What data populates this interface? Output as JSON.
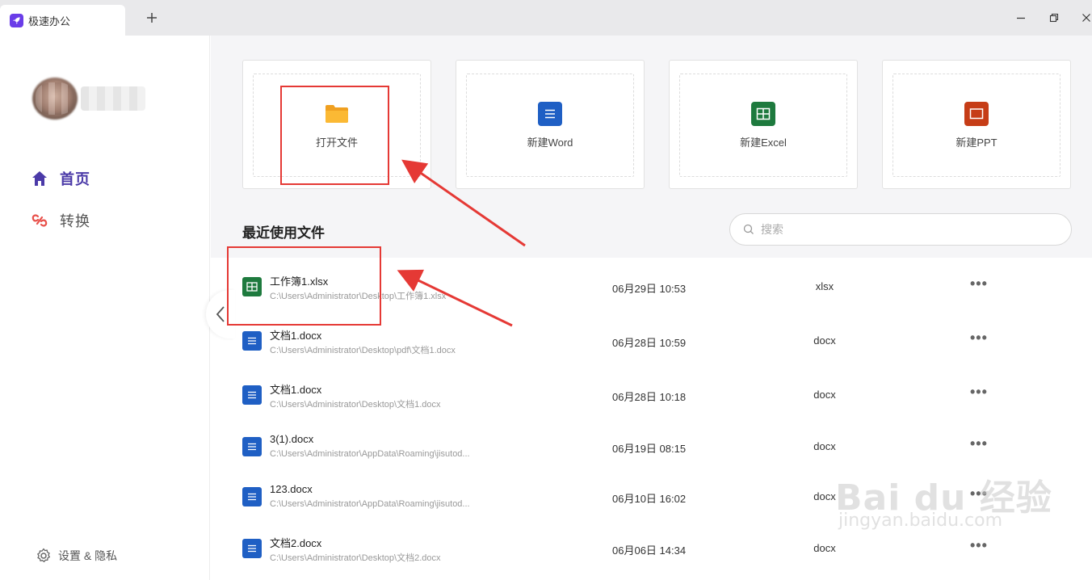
{
  "window": {
    "tab_title": "极速办公",
    "new_tab_symbol": "+"
  },
  "sidebar": {
    "nav": [
      {
        "label": "首页",
        "icon": "home-icon",
        "active": true
      },
      {
        "label": "转换",
        "icon": "convert-icon",
        "active": false
      }
    ],
    "settings_label": "设置 & 隐私"
  },
  "actions": [
    {
      "label": "打开文件",
      "icon": "folder-icon",
      "color": "#f5a623"
    },
    {
      "label": "新建Word",
      "icon": "word-icon",
      "color": "#1f5fc4"
    },
    {
      "label": "新建Excel",
      "icon": "excel-icon",
      "color": "#1e7a3e"
    },
    {
      "label": "新建PPT",
      "icon": "ppt-icon",
      "color": "#c63d17"
    }
  ],
  "recent": {
    "title": "最近使用文件",
    "search_placeholder": "搜索",
    "files": [
      {
        "name": "工作簿1.xlsx",
        "path": "C:\\Users\\Administrator\\Desktop\\工作簿1.xlsx",
        "date": "06月29日 10:53",
        "type": "xlsx",
        "icon": "excel-file-icon"
      },
      {
        "name": "文档1.docx",
        "path": "C:\\Users\\Administrator\\Desktop\\pdf\\文档1.docx",
        "date": "06月28日 10:59",
        "type": "docx",
        "icon": "word-file-icon"
      },
      {
        "name": "文档1.docx",
        "path": "C:\\Users\\Administrator\\Desktop\\文档1.docx",
        "date": "06月28日 10:18",
        "type": "docx",
        "icon": "word-file-icon"
      },
      {
        "name": "3(1).docx",
        "path": "C:\\Users\\Administrator\\AppData\\Roaming\\jisutod...",
        "date": "06月19日 08:15",
        "type": "docx",
        "icon": "word-file-icon"
      },
      {
        "name": "123.docx",
        "path": "C:\\Users\\Administrator\\AppData\\Roaming\\jisutod...",
        "date": "06月10日 16:02",
        "type": "docx",
        "icon": "word-file-icon"
      },
      {
        "name": "文档2.docx",
        "path": "C:\\Users\\Administrator\\Desktop\\文档2.docx",
        "date": "06月06日 14:34",
        "type": "docx",
        "icon": "word-file-icon"
      }
    ],
    "more_symbol": "•••"
  },
  "watermark": {
    "main": "Bai du 经验",
    "sub": "jingyan.baidu.com"
  },
  "colors": {
    "accent": "#4b3aa8",
    "annotation": "#e53935"
  }
}
